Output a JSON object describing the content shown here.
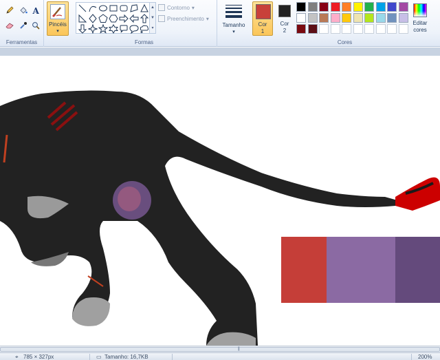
{
  "ribbon": {
    "groups": {
      "tools": "Ferramentas",
      "shapes": "Formas",
      "colors": "Cores"
    },
    "brushes_label": "Pincéis",
    "outline_label": "Contorno",
    "fill_label": "Preenchimento",
    "size_label": "Tamanho",
    "color1_label": "Cor\n1",
    "color2_label": "Cor\n2",
    "edit_colors_label": "Editar\ncores",
    "color1_value": "#c8403a",
    "color2_value": "#222222",
    "palette_row1": [
      "#000000",
      "#7f7f7f",
      "#880015",
      "#ed1c24",
      "#ff7f27",
      "#fff200",
      "#22b14c",
      "#00a2e8",
      "#3f48cc",
      "#a349a4"
    ],
    "palette_row2": [
      "#ffffff",
      "#c3c3c3",
      "#b97a57",
      "#ffaec9",
      "#ffc90e",
      "#efe4b0",
      "#b5e61d",
      "#99d9ea",
      "#7092be",
      "#c8bfe7"
    ],
    "palette_row3": [
      "#7a0a10",
      "#5c0f16",
      "",
      "",
      "",
      "",
      "",
      "",
      "",
      ""
    ]
  },
  "canvas": {
    "sample_swatches": [
      "#c53e38",
      "#8b6aa3",
      "#644a7c"
    ]
  },
  "status": {
    "cursor_pos": "785 × 327px",
    "file_size": "Tamanho: 16,7KB",
    "zoom": "200%"
  }
}
